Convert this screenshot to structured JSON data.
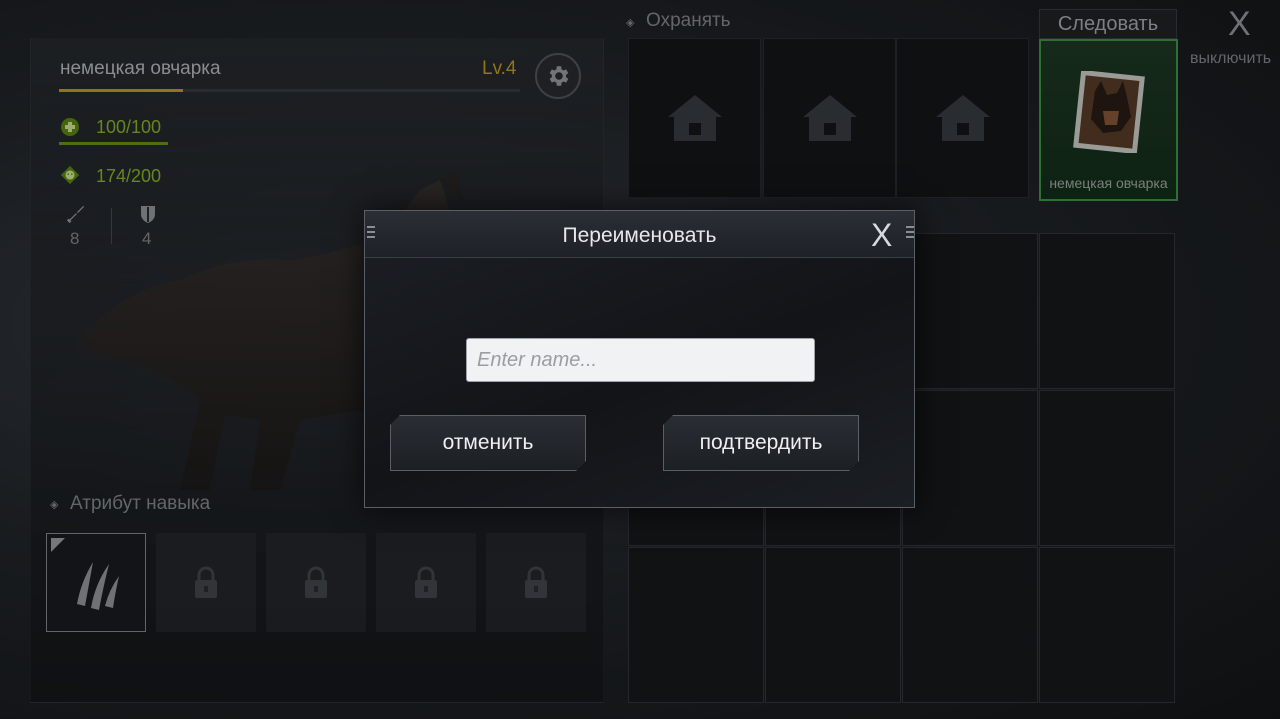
{
  "pet": {
    "name": "немецкая овчарка",
    "level": "Lv.4",
    "xp_fraction": 0.27,
    "health": "100/100",
    "mood": "174/200",
    "attack": "8",
    "defense": "4",
    "skills_title": "Атрибут навыка",
    "skill_slots": [
      {
        "state": "unlocked",
        "icon": "claw-mark-icon"
      },
      {
        "state": "locked",
        "icon": "lock-icon"
      },
      {
        "state": "locked",
        "icon": "lock-icon"
      },
      {
        "state": "locked",
        "icon": "lock-icon"
      },
      {
        "state": "locked",
        "icon": "lock-icon"
      }
    ]
  },
  "guard": {
    "title": "Охранять",
    "slots": [
      {
        "icon": "house-icon"
      },
      {
        "icon": "house-icon"
      },
      {
        "icon": "house-icon"
      }
    ]
  },
  "follow": {
    "title": "Следовать",
    "pet_name": "немецкая овчарка"
  },
  "close_button": {
    "icon": "X",
    "label": "выключить"
  },
  "modal": {
    "title": "Переименовать",
    "close": "X",
    "input_placeholder": "Enter name...",
    "input_value": "",
    "cancel_label": "отменить",
    "confirm_label": "подтвердить"
  },
  "colors": {
    "level": "#c9a227",
    "health": "#8fbb2a",
    "follow_border": "#3f9a4b"
  }
}
